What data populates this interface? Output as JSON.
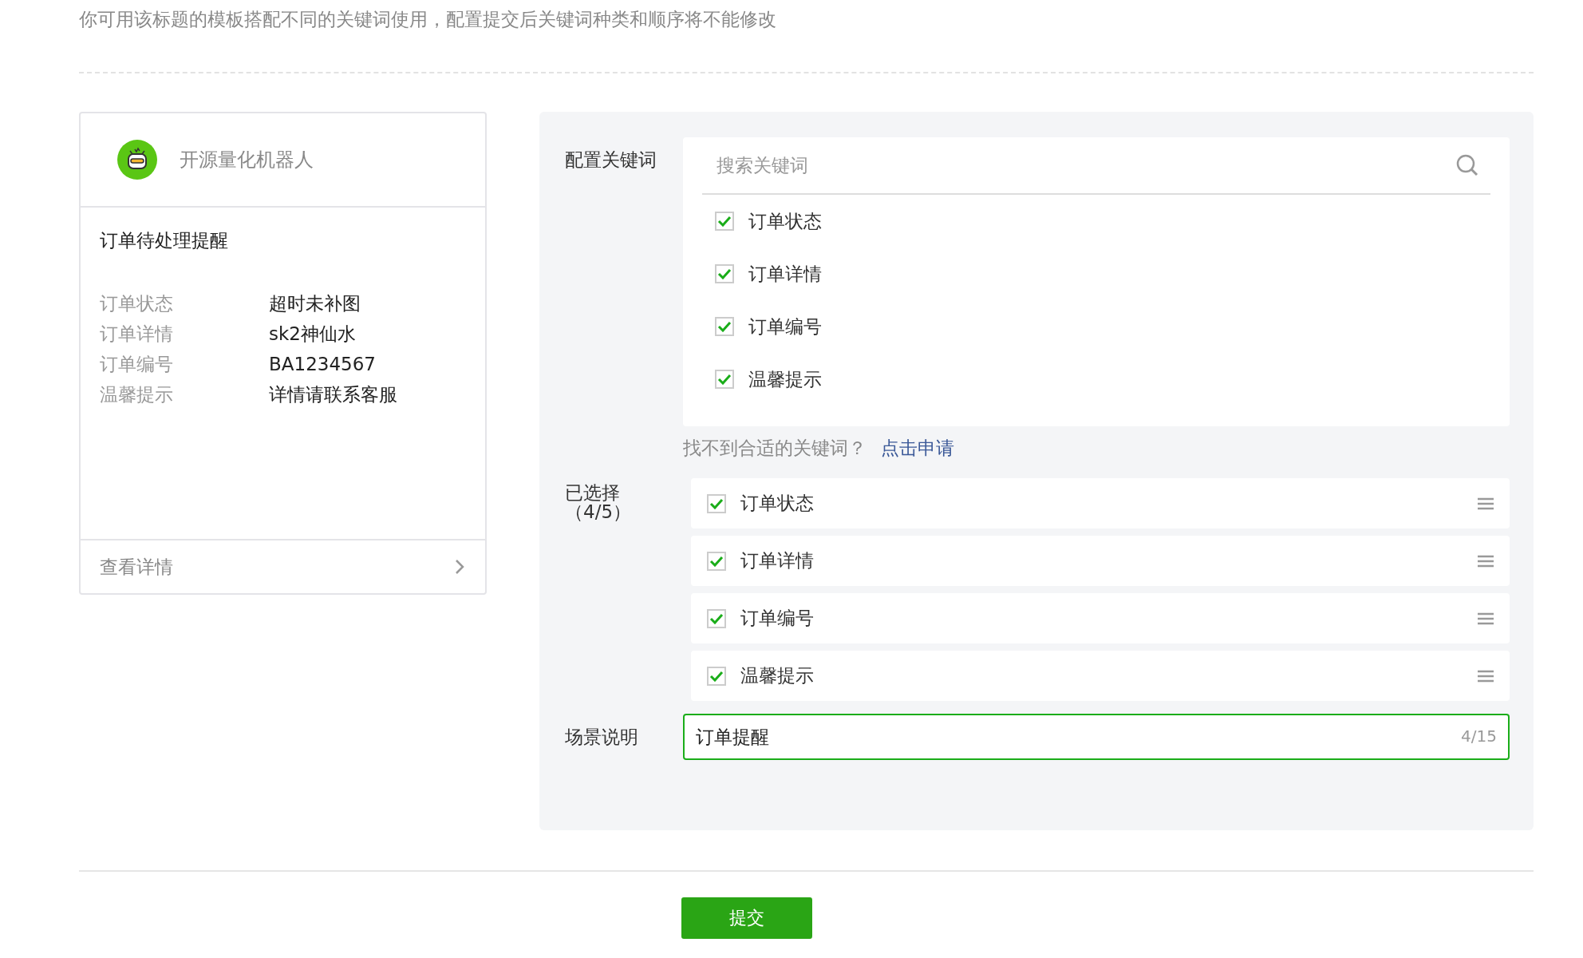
{
  "intro": "你可用该标题的模板搭配不同的关键词使用，配置提交后关键词种类和顺序将不能修改",
  "preview": {
    "account": "开源量化机器人",
    "title": "订单待处理提醒",
    "fields": [
      {
        "label": "订单状态",
        "value": "超时未补图"
      },
      {
        "label": "订单详情",
        "value": "sk2神仙水"
      },
      {
        "label": "订单编号",
        "value": "BA1234567"
      },
      {
        "label": "温馨提示",
        "value": "详情请联系客服"
      }
    ],
    "footer": "查看详情"
  },
  "config": {
    "keywords_label": "配置关键词",
    "search": {
      "placeholder": "搜索关键词"
    },
    "keywords": [
      {
        "label": "订单状态",
        "checked": true
      },
      {
        "label": "订单详情",
        "checked": true
      },
      {
        "label": "订单编号",
        "checked": true
      },
      {
        "label": "温馨提示",
        "checked": true
      }
    ],
    "hint": "找不到合适的关键词？",
    "apply_link": "点击申请",
    "selected_label": "已选择（4/5）",
    "selected": [
      {
        "label": "订单状态",
        "checked": true
      },
      {
        "label": "订单详情",
        "checked": true
      },
      {
        "label": "订单编号",
        "checked": true
      },
      {
        "label": "温馨提示",
        "checked": true
      }
    ],
    "scene_label": "场景说明",
    "scene": {
      "value": "订单提醒",
      "counter": "4/15"
    }
  },
  "submit": "提交"
}
